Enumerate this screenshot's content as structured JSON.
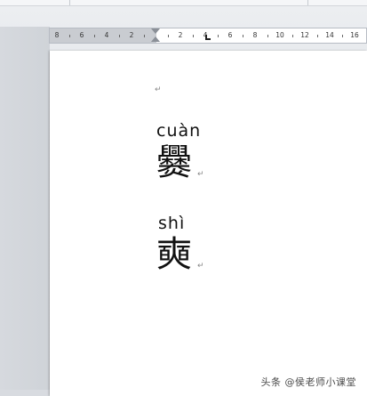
{
  "ruler": {
    "ticks": [
      "8",
      "6",
      "4",
      "2",
      "2",
      "4",
      "6",
      "8",
      "10",
      "12",
      "14",
      "16"
    ]
  },
  "document": {
    "empty_paragraph_mark": "↵",
    "entries": [
      {
        "pinyin": "cuàn",
        "character": "爨",
        "mark": "↵"
      },
      {
        "pinyin": "shì",
        "character": "奭",
        "mark": "↵"
      }
    ]
  },
  "watermark": "头条 @侯老师小课堂",
  "colors": {
    "workspace": "#dfe2e6",
    "page": "#ffffff",
    "ruler_margin": "#c9ccd1"
  }
}
